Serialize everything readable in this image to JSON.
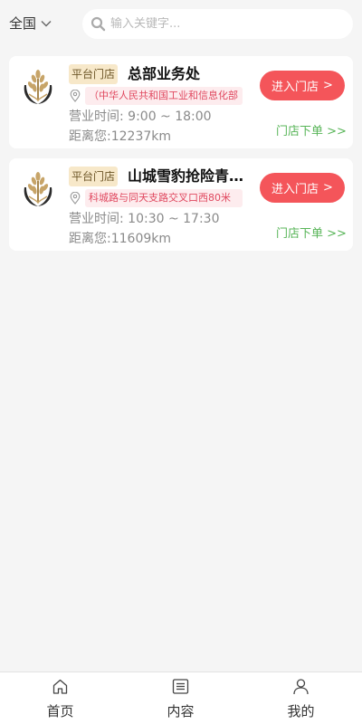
{
  "header": {
    "region_label": "全国",
    "search": {
      "placeholder": "输入关键字..."
    }
  },
  "stores": [
    {
      "tag": "平台门店",
      "name": "总部业务处",
      "address": "（中华人民共和国工业和信息化部",
      "hours": "营业时间: 9:00 ~ 18:00",
      "distance": "距离您:12237km",
      "enter_label": "进入门店",
      "enter_arrow": ">",
      "order_label": "门店下单 >>"
    },
    {
      "tag": "平台门店",
      "name": "山城雪豹抢险青年突击队",
      "address": "科城路与同天支路交叉口西80米",
      "hours": "营业时间: 10:30 ~ 17:30",
      "distance": "距离您:11609km",
      "enter_label": "进入门店",
      "enter_arrow": ">",
      "order_label": "门店下单 >>"
    }
  ],
  "tabbar": {
    "items": [
      {
        "label": "首页",
        "icon": "home-icon"
      },
      {
        "label": "内容",
        "icon": "list-icon"
      },
      {
        "label": "我的",
        "icon": "user-icon"
      }
    ]
  },
  "colors": {
    "accent": "#f4555a",
    "tag_bg": "#f7e8c9",
    "address_bg": "#fdecee",
    "address_text": "#e0485f",
    "order_link": "#58b558",
    "logo_gold": "#c7a468",
    "logo_dark": "#2b2b2b"
  }
}
